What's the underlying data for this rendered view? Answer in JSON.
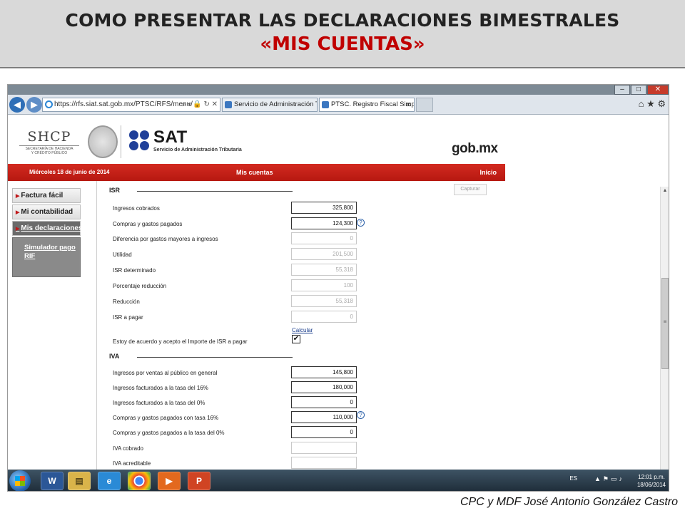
{
  "slide": {
    "title": "COMO PRESENTAR LAS DECLARACIONES BIMESTRALES",
    "subtitle": "«MIS CUENTAS»",
    "footer": "CPC y MDF José Antonio González Castro"
  },
  "browser": {
    "address": "https://rfs.siat.sat.gob.mx/PTSC/RFS/menu/",
    "address_tools": "⌕ ▾ 🔒 ↻ ✕",
    "tabs": [
      {
        "label": "Servicio de Administración Tri..."
      },
      {
        "label": "PTSC. Registro Fiscal Simpli..."
      }
    ],
    "right_icons": "⌂ ★ ⚙"
  },
  "site": {
    "shcp_logo": "SHCP",
    "shcp_sub_line1": "SECRETARÍA DE HACIENDA",
    "shcp_sub_line2": "Y CRÉDITO PÚBLICO",
    "sat_name": "SAT",
    "sat_sub": "Servicio de Administración Tributaria",
    "gobmx": "gob.mx",
    "red_bar": {
      "date": "Miércoles 18 de junio de 2014",
      "center": "Mis cuentas",
      "home": "Inicio"
    }
  },
  "sidebar": {
    "items": [
      {
        "label": "Factura fácil"
      },
      {
        "label": "Mi contabilidad"
      },
      {
        "label": "Mis declaraciones"
      }
    ],
    "sub_line1": "Simulador pago",
    "sub_line2": "RIF"
  },
  "form": {
    "capture_button": "Capturar",
    "isr": {
      "heading": "ISR",
      "fields": [
        {
          "label": "Ingresos cobrados",
          "value": "325,800"
        },
        {
          "label": "Compras y gastos pagados",
          "value": "124,300"
        },
        {
          "label": "Diferencia por gastos mayores a ingresos",
          "value": "0"
        },
        {
          "label": "Utilidad",
          "value": "201,500"
        },
        {
          "label": "ISR determinado",
          "value": "55,318"
        },
        {
          "label": "Porcentaje reducción",
          "value": "100"
        },
        {
          "label": "Reducción",
          "value": "55,318"
        },
        {
          "label": "ISR a pagar",
          "value": "0"
        }
      ],
      "calc_link": "Calcular",
      "agree_label": "Estoy de acuerdo y acepto el Importe de ISR a pagar",
      "agree_checked": true
    },
    "iva": {
      "heading": "IVA",
      "fields": [
        {
          "label": "Ingresos por ventas al público en general",
          "value": "145,800"
        },
        {
          "label": "Ingresos facturados a la tasa del 16%",
          "value": "180,000"
        },
        {
          "label": "Ingresos facturados a la tasa del 0%",
          "value": "0"
        },
        {
          "label": "Compras y gastos pagados con tasa 16%",
          "value": "110,000"
        },
        {
          "label": "Compras y gastos pagados a la tasa del 0%",
          "value": "0"
        },
        {
          "label": "IVA cobrado",
          "value": ""
        },
        {
          "label": "IVA acreditable",
          "value": ""
        }
      ]
    }
  },
  "taskbar": {
    "lang": "ES",
    "time": "12:01 p.m.",
    "date": "18/06/2014"
  }
}
